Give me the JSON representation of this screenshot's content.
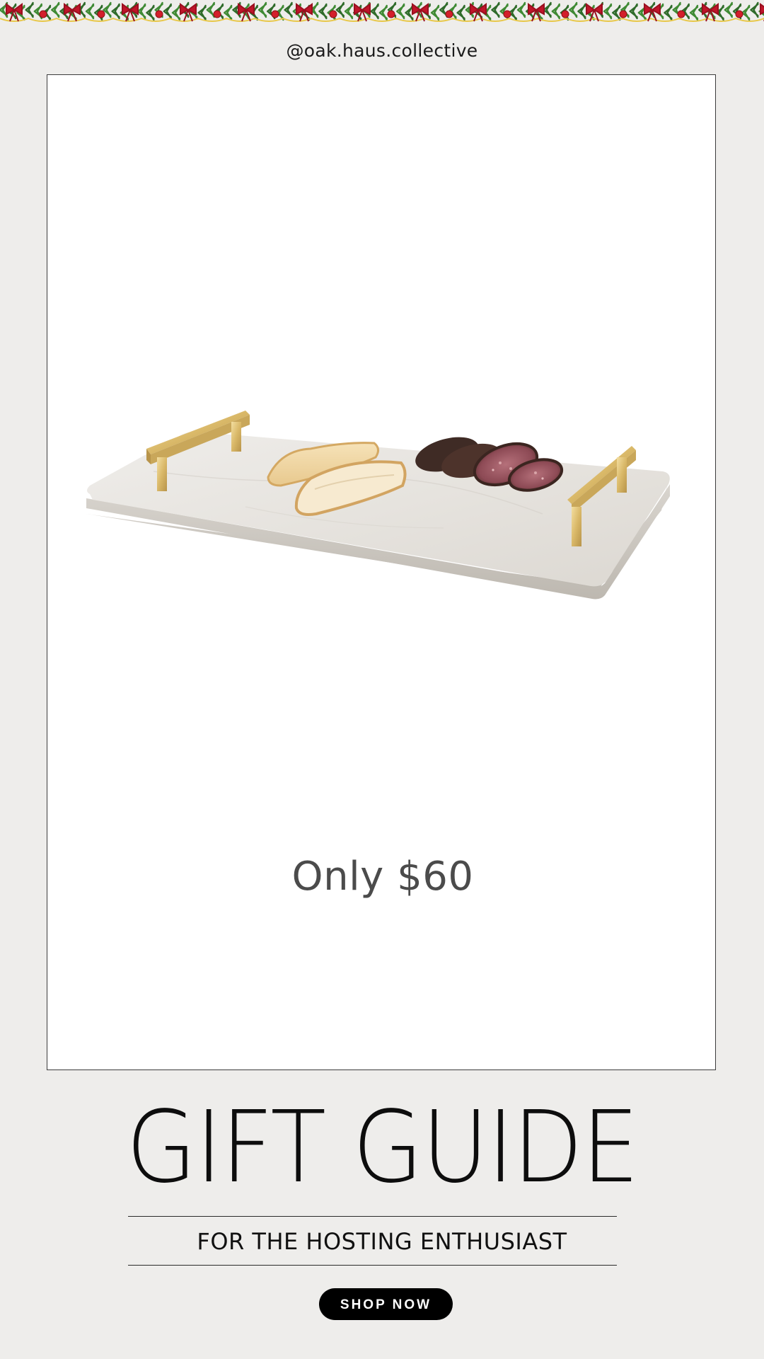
{
  "header": {
    "handle": "@oak.haus.collective"
  },
  "product": {
    "price_text": "Only $60",
    "image_icon": "marble-serving-board-image"
  },
  "banner": {
    "title": "GIFT GUIDE",
    "subtitle": "FOR THE HOSTING ENTHUSIAST"
  },
  "cta": {
    "label": "SHOP NOW"
  },
  "colors": {
    "page_background": "#eeedeb",
    "card_background": "#ffffff",
    "button_background": "#000000",
    "button_text": "#ffffff",
    "price_text": "#4b4b4b"
  }
}
